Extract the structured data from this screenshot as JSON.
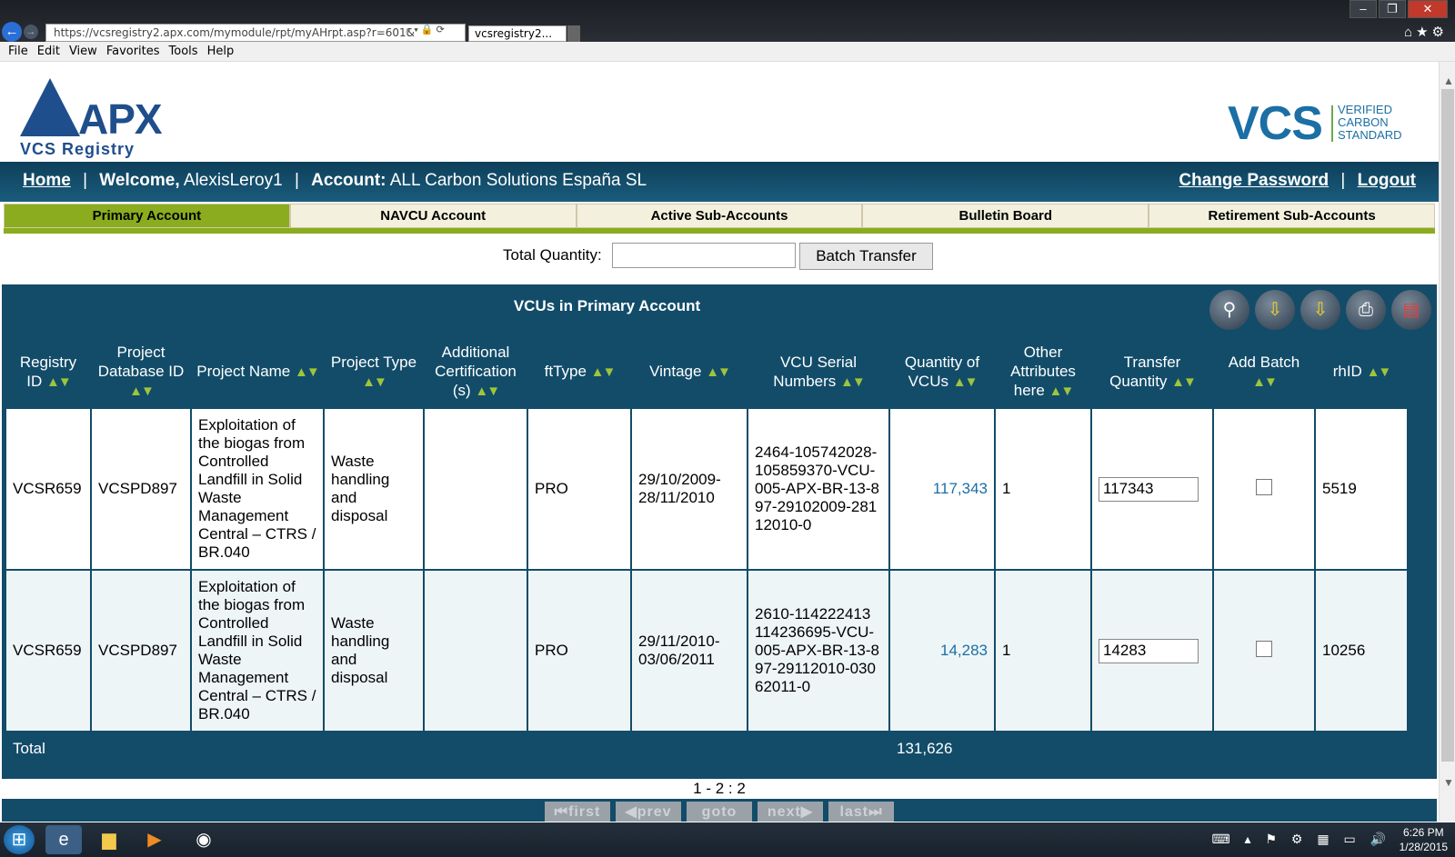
{
  "browser": {
    "url": "https://vcsregistry2.apx.com/mymodule/rpt/myAHrpt.asp?r=601&",
    "tab_title": "vcsregistry2...",
    "menu": [
      "File",
      "Edit",
      "View",
      "Favorites",
      "Tools",
      "Help"
    ]
  },
  "header": {
    "logo_apx": "APX",
    "logo_apx_sub": "VCS Registry",
    "logo_vcs": "VCS",
    "logo_vcs_full": "VERIFIED CARBON STANDARD",
    "home": "Home",
    "welcome_label": "Welcome,",
    "user": "AlexisLeroy1",
    "account_label": "Account:",
    "account": "ALL Carbon Solutions España SL",
    "change_password": "Change Password",
    "logout": "Logout",
    "sep": "|"
  },
  "tabs": [
    "Primary Account",
    "NAVCU Account",
    "Active Sub-Accounts",
    "Bulletin Board",
    "Retirement Sub-Accounts"
  ],
  "transfer": {
    "label": "Total Quantity:",
    "value": "",
    "button": "Batch Transfer"
  },
  "vcu_table": {
    "title": "VCUs in Primary Account",
    "columns": [
      "Registry ID",
      "Project Database ID",
      "Project Name",
      "Project Type",
      "Additional Certification (s)",
      "ftType",
      "Vintage",
      "VCU Serial Numbers",
      "Quantity of VCUs",
      "Other Attributes here",
      "Transfer Quantity",
      "Add Batch",
      "rhID"
    ],
    "rows": [
      {
        "registry_id": "VCSR659",
        "project_db_id": "VCSPD897",
        "project_name": "Exploitation of the biogas from Controlled Landfill in Solid Waste Management Central – CTRS / BR.040",
        "project_type": "Waste handling and disposal",
        "additional_cert": "",
        "fttype": "PRO",
        "vintage": "29/10/2009-28/11/2010",
        "serial": "2464-105742028-105859370-VCU-005-APX-BR-13-897-29102009-28112010-0",
        "quantity": "117,343",
        "other": "1",
        "transfer_qty": "117343",
        "rhid": "5519"
      },
      {
        "registry_id": "VCSR659",
        "project_db_id": "VCSPD897",
        "project_name": "Exploitation of the biogas from Controlled Landfill in Solid Waste Management Central – CTRS / BR.040",
        "project_type": "Waste handling and disposal",
        "additional_cert": "",
        "fttype": "PRO",
        "vintage": "29/11/2010-03/06/2011",
        "serial": "2610-114222413 114236695-VCU-005-APX-BR-13-897-29112010-03062011-0",
        "quantity": "14,283",
        "other": "1",
        "transfer_qty": "14283",
        "rhid": "10256"
      }
    ],
    "total_label": "Total",
    "total_quantity": "131,626",
    "pager_info": "1 - 2 : 2",
    "pager_buttons": [
      "first",
      "prev",
      "goto",
      "next",
      "last"
    ]
  },
  "taskbar": {
    "time": "6:26 PM",
    "date": "1/28/2015"
  },
  "colors": {
    "header_bar": "#124c69",
    "tab_active": "#8aac1e",
    "link": "#1b6fa5"
  }
}
